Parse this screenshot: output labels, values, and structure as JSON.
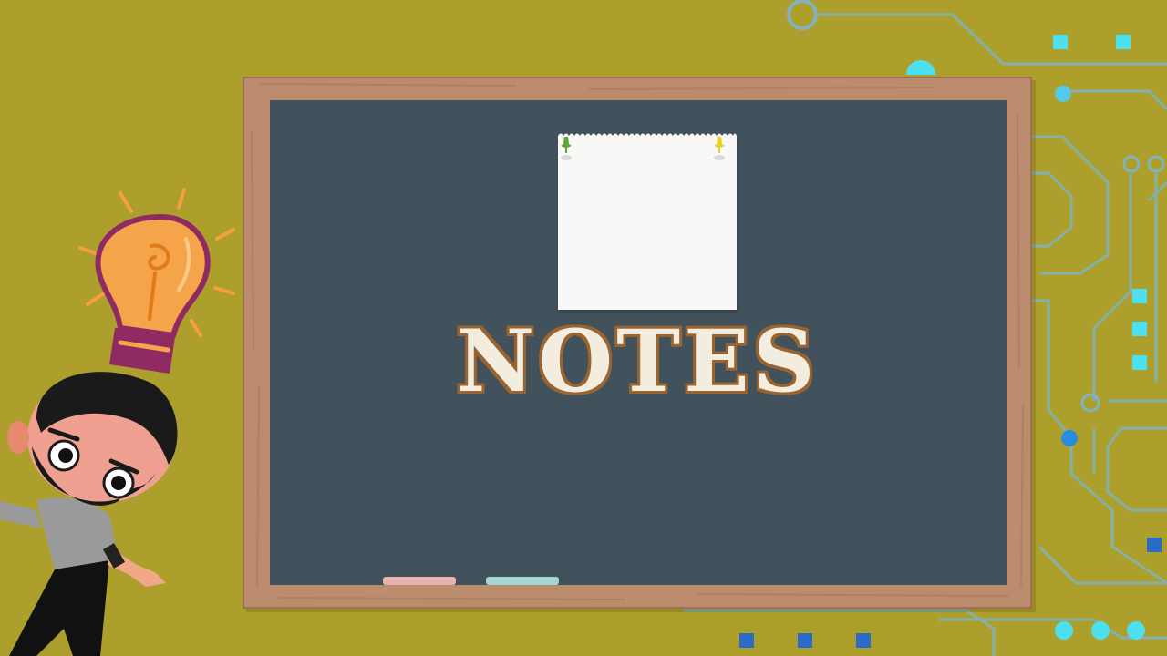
{
  "board": {
    "title": "NOTES"
  },
  "colors": {
    "background": "#ad9f2c",
    "board_surface": "#41525c",
    "board_frame": "#bb8d6e",
    "title_fill": "#f3ede0",
    "title_outline": "#9a6431",
    "circuit_line": "#7fb3c0",
    "circuit_node": "#4de0f0",
    "circuit_node_dark": "#2a6cc8"
  },
  "icons": {
    "bulb": "light-bulb-icon",
    "pin_left": "green-push-pin-icon",
    "pin_right": "yellow-push-pin-icon"
  }
}
